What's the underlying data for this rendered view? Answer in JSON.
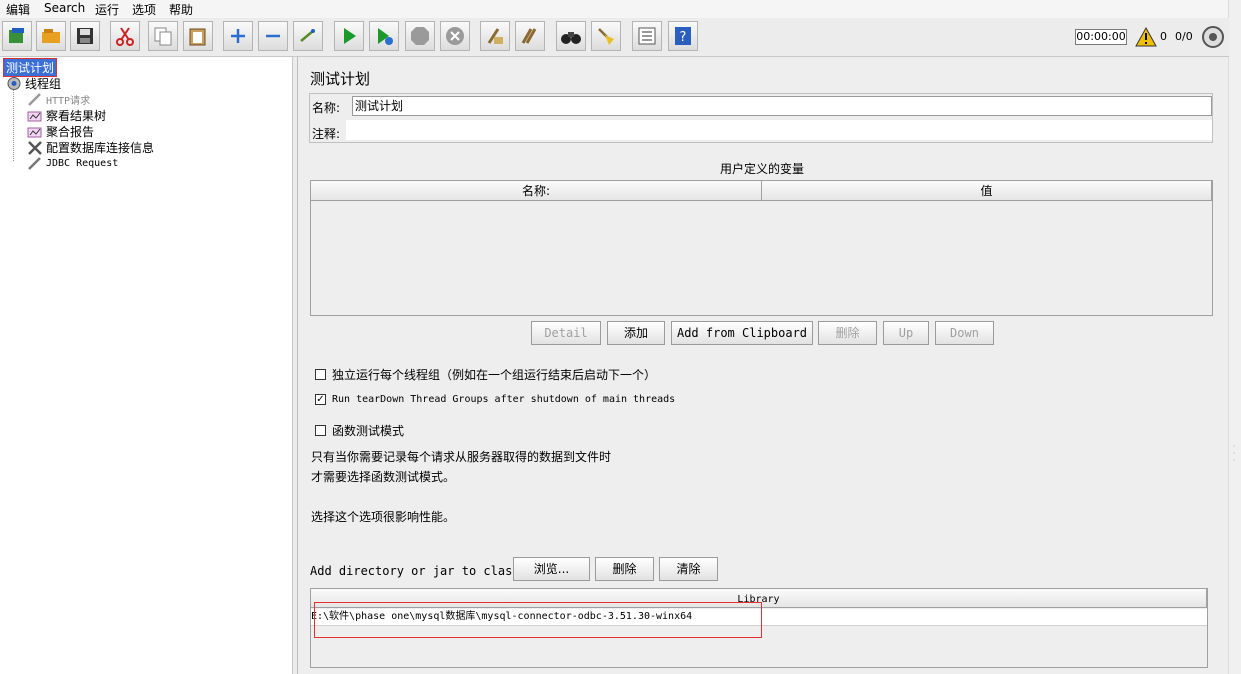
{
  "menu": [
    "编辑",
    "Search",
    "运行",
    "选项",
    "帮助"
  ],
  "toolbar": {
    "buttons": [
      "templates-icon",
      "open-icon",
      "save-icon",
      "cut-icon",
      "copy-icon",
      "paste-icon",
      "expand-icon",
      "collapse-icon",
      "toggle-icon",
      "start-icon",
      "start-no-pause-icon",
      "stop-icon",
      "shutdown-icon",
      "clear-icon",
      "clear-all-icon",
      "search-icon",
      "reset-search-icon",
      "function-helper-icon",
      "help-icon"
    ],
    "timer": "00:00:00",
    "warning_count": "0",
    "threads": "0/0"
  },
  "tree": {
    "items": [
      {
        "label": "测试计划",
        "icon": "test-plan-icon"
      },
      {
        "label": "线程组",
        "icon": "gear-icon"
      },
      {
        "label": "HTTP请求",
        "icon": "sampler-icon"
      },
      {
        "label": "察看结果树",
        "icon": "listener-icon"
      },
      {
        "label": "聚合报告",
        "icon": "listener-icon"
      },
      {
        "label": "配置数据库连接信息",
        "icon": "config-icon"
      },
      {
        "label": "JDBC Request",
        "icon": "sampler-icon"
      }
    ]
  },
  "main": {
    "title": "测试计划",
    "name_label": "名称:",
    "name_value": "测试计划",
    "comment_label": "注释:",
    "comment_value": "",
    "vars_title": "用户定义的变量",
    "vars_headers": [
      "名称:",
      "值"
    ],
    "buttons": [
      "Detail",
      "添加",
      "Add from Clipboard",
      "删除",
      "Up",
      "Down"
    ],
    "checkbox1": {
      "label": "独立运行每个线程组（例如在一个组运行结束后启动下一个）",
      "checked": false
    },
    "checkbox2": {
      "label": "Run tearDown Thread Groups after shutdown of main threads",
      "checked": true
    },
    "checkbox3": {
      "label": "函数测试模式",
      "checked": false
    },
    "help1": "只有当你需要记录每个请求从服务器取得的数据到文件时",
    "help2": "才需要选择函数测试模式。",
    "help3": "选择这个选项很影响性能。",
    "classpath_label": "Add directory or jar to classpath",
    "classpath_buttons": [
      "浏览...",
      "删除",
      "清除"
    ],
    "library_header": "Library",
    "library_rows": [
      "E:\\软件\\phase one\\mysql数据库\\mysql-connector-odbc-3.51.30-winx64"
    ]
  }
}
